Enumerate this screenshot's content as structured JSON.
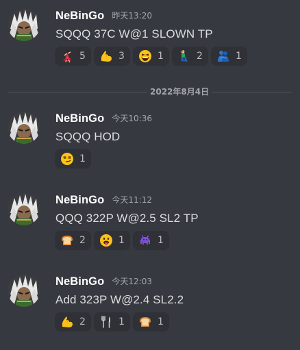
{
  "divider": {
    "label": "2022年8月4日"
  },
  "messages": [
    {
      "username": "NeBinGo",
      "timestamp": "昨天13:20",
      "content": "SQQQ 37C W@1 SLOWN TP",
      "reactions": [
        {
          "emoji": "dancer",
          "count": "5"
        },
        {
          "emoji": "flexed-biceps",
          "count": "3"
        },
        {
          "emoji": "grinning-squinting",
          "count": "1"
        },
        {
          "emoji": "person-kneeling",
          "count": "2"
        },
        {
          "emoji": "people-hugging",
          "count": "1"
        }
      ]
    },
    {
      "username": "NeBinGo",
      "timestamp": "今天10:36",
      "content": "SQQQ HOD",
      "reactions": [
        {
          "emoji": "smirking-face",
          "count": "1"
        }
      ]
    },
    {
      "username": "NeBinGo",
      "timestamp": "今天11:12",
      "content": "QQQ 322P W@2.5 SL2 TP",
      "reactions": [
        {
          "emoji": "bread",
          "count": "2"
        },
        {
          "emoji": "tongue-face",
          "count": "1"
        },
        {
          "emoji": "alien-monster",
          "count": "1"
        }
      ]
    },
    {
      "username": "NeBinGo",
      "timestamp": "今天12:03",
      "content": "Add 323P W@2.4 SL2.2",
      "reactions": [
        {
          "emoji": "flexed-biceps",
          "count": "2"
        },
        {
          "emoji": "fork-and-knife",
          "count": "1"
        },
        {
          "emoji": "bread",
          "count": "1"
        }
      ]
    }
  ]
}
